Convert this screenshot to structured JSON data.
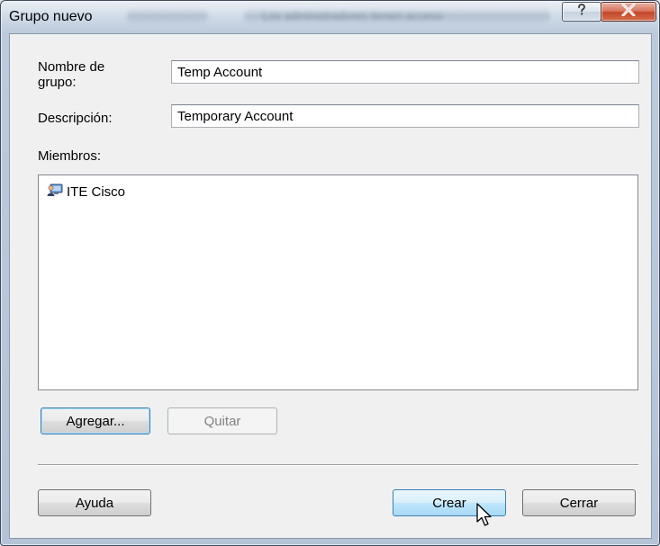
{
  "window": {
    "title": "Grupo nuevo",
    "background_title": "Los administradores tienen acceso"
  },
  "titlebar_buttons": {
    "help_icon": "question-mark-icon",
    "close_icon": "close-x-icon"
  },
  "form": {
    "group_name_label": "Nombre de grupo:",
    "group_name_value": "Temp Account",
    "description_label": "Descripción:",
    "description_value": "Temporary Account",
    "members_label": "Miembros:"
  },
  "members": [
    {
      "name": "ITE Cisco",
      "icon": "user-account-icon"
    }
  ],
  "buttons": {
    "add_label": "Agregar...",
    "remove_label": "Quitar",
    "help_label": "Ayuda",
    "create_label": "Crear",
    "close_label": "Cerrar"
  },
  "colors": {
    "titlebar": "#bccbdc",
    "close_button": "#c24828",
    "focus_border": "#3c7fb1",
    "dialog_background": "#f0f0f0"
  }
}
